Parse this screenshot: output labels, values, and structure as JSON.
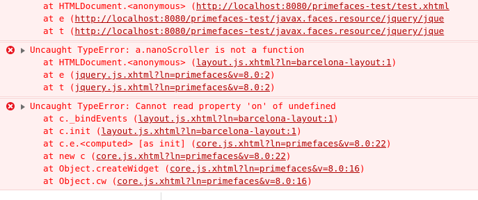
{
  "colors": {
    "error_text": "#ff0000",
    "link_text": "#b00000",
    "error_background": "#fff0f0",
    "error_border": "#f7d3d3",
    "error_icon": "#e8141e"
  },
  "messages": [
    {
      "frames": [
        {
          "prefix": "at HTMLDocument.<anonymous> (",
          "link": "http://localhost:8080/primefaces-test/test.xhtml",
          "suffix": ""
        },
        {
          "prefix": "at e (",
          "link": "http://localhost:8080/primefaces-test/javax.faces.resource/jquery/jque",
          "suffix": ""
        },
        {
          "prefix": "at t (",
          "link": "http://localhost:8080/primefaces-test/javax.faces.resource/jquery/jque",
          "suffix": ""
        }
      ]
    },
    {
      "icon": "error-icon",
      "title": "Uncaught TypeError: a.nanoScroller is not a function",
      "frames": [
        {
          "prefix": "at HTMLDocument.<anonymous> (",
          "link": "layout.js.xhtml?ln=barcelona-layout:1",
          "suffix": ")"
        },
        {
          "prefix": "at e (",
          "link": "jquery.js.xhtml?ln=primefaces&v=8.0:2",
          "suffix": ")"
        },
        {
          "prefix": "at t (",
          "link": "jquery.js.xhtml?ln=primefaces&v=8.0:2",
          "suffix": ")"
        }
      ]
    },
    {
      "icon": "error-icon",
      "title": "Uncaught TypeError: Cannot read property 'on' of undefined",
      "frames": [
        {
          "prefix": "at c._bindEvents (",
          "link": "layout.js.xhtml?ln=barcelona-layout:1",
          "suffix": ")"
        },
        {
          "prefix": "at c.init (",
          "link": "layout.js.xhtml?ln=barcelona-layout:1",
          "suffix": ")"
        },
        {
          "prefix": "at c.e.<computed> [as init] (",
          "link": "core.js.xhtml?ln=primefaces&v=8.0:22",
          "suffix": ")"
        },
        {
          "prefix": "at new c (",
          "link": "core.js.xhtml?ln=primefaces&v=8.0:22",
          "suffix": ")"
        },
        {
          "prefix": "at Object.createWidget (",
          "link": "core.js.xhtml?ln=primefaces&v=8.0:16",
          "suffix": ")"
        },
        {
          "prefix": "at Object.cw (",
          "link": "core.js.xhtml?ln=primefaces&v=8.0:16",
          "suffix": ")"
        }
      ]
    }
  ]
}
